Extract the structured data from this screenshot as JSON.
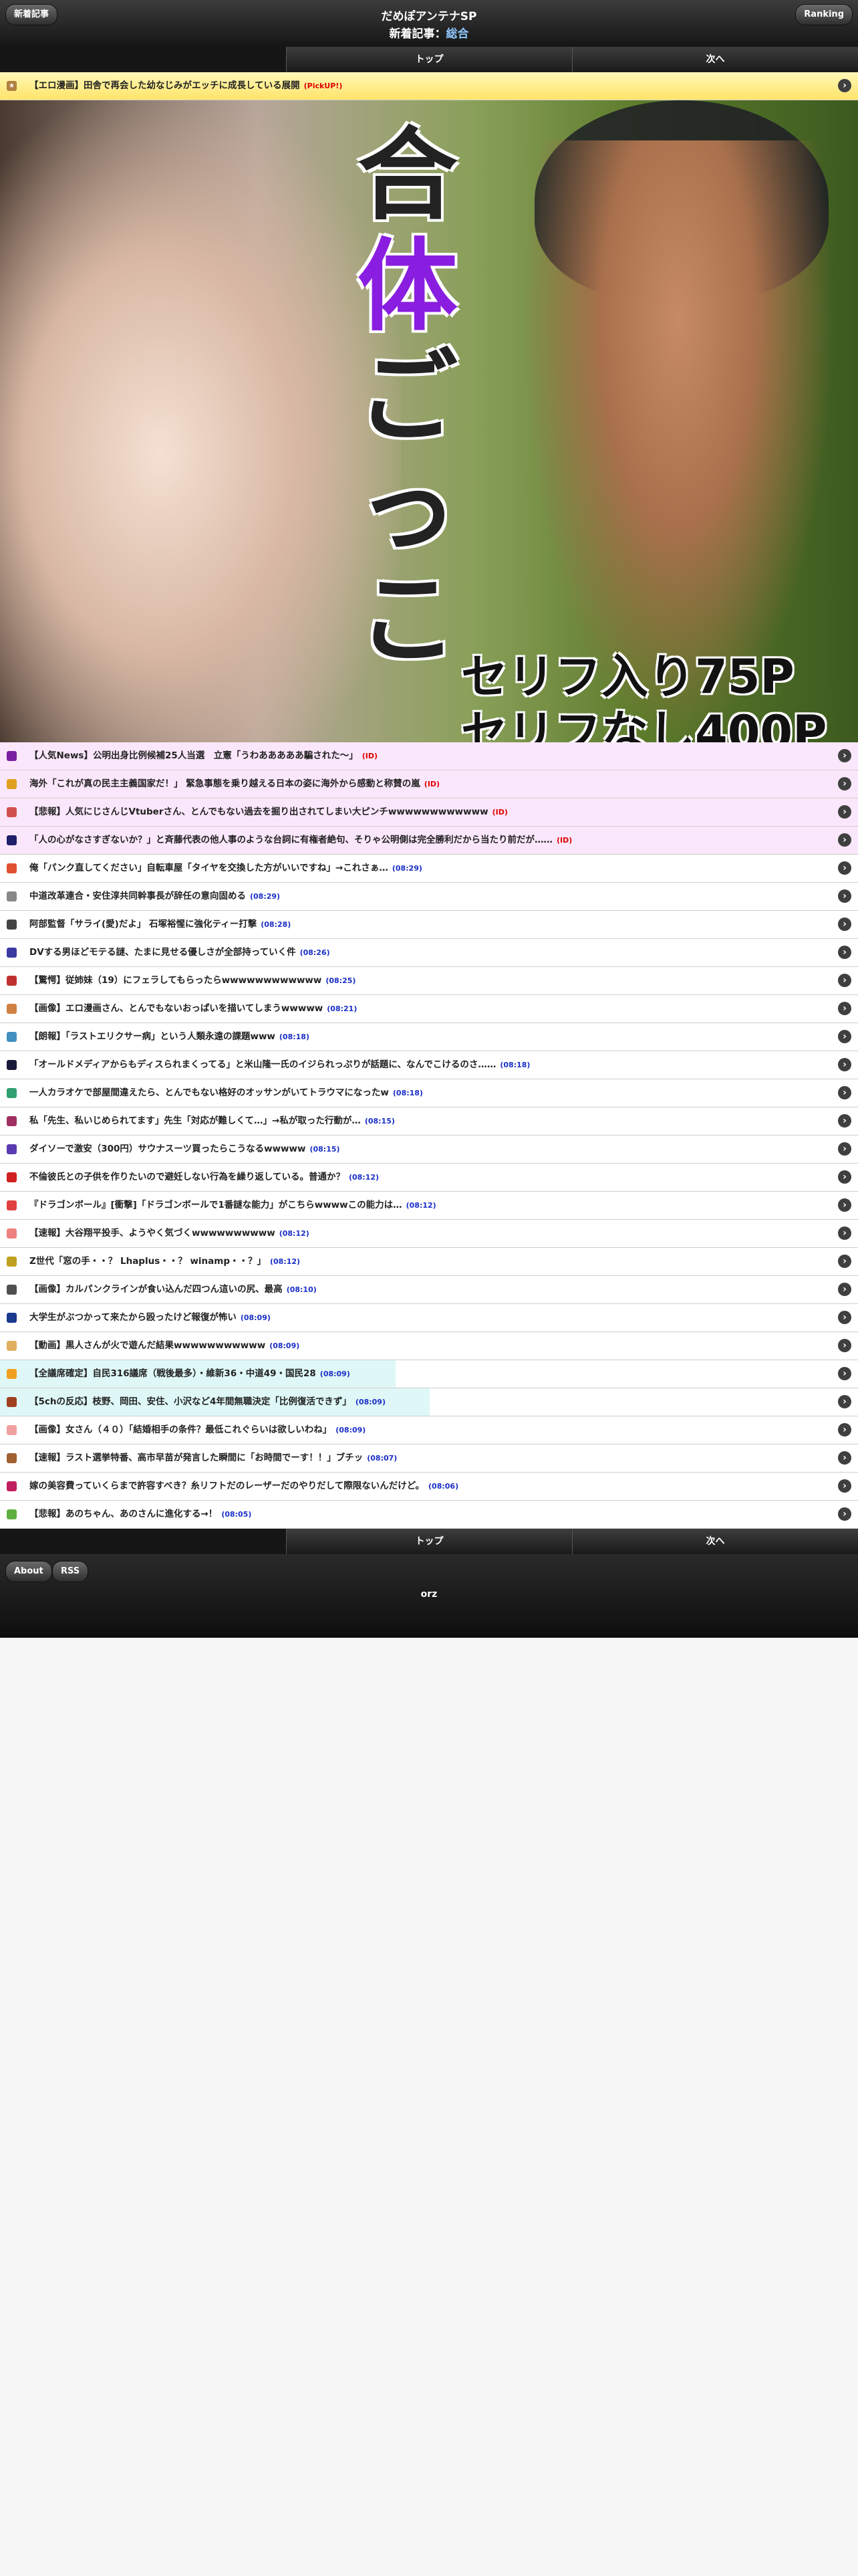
{
  "header": {
    "site": "だめぽアンテナSP",
    "sub_prefix": "新着記事：",
    "sub_category": "総合",
    "left_button": "新着記事",
    "right_button": "Ranking"
  },
  "nav": {
    "top": "トップ",
    "next": "次へ"
  },
  "pick": {
    "title": "【エロ漫画】田舎で再会した幼なじみがエッチに成長している展開",
    "mark": "(PickUP!)"
  },
  "hero": {
    "title_lines": [
      "合",
      "体",
      "ご",
      "っ",
      "こ"
    ],
    "caption_line1": "セリフ入り75P",
    "caption_line2": "セリフなし400P"
  },
  "articles": [
    {
      "title": "【人気News】公明出身比例候補25人当選　立憲「うわあああああ騙された〜」",
      "time": "(ID)",
      "style": "pink",
      "red": true,
      "icon_color": "#7a1fa0"
    },
    {
      "title": "海外「これが真の民主主義国家だ！」 緊急事態を乗り越える日本の姿に海外から感動と称賛の嵐",
      "time": "(ID)",
      "style": "pink",
      "red": true,
      "icon_color": "#e0a020"
    },
    {
      "title": "【悲報】人気にじさんじVtuberさん、とんでもない過去を掘り出されてしまい大ピンチwwwwwwwwwwww",
      "time": "(ID)",
      "style": "pink",
      "red": true,
      "icon_color": "#d05050"
    },
    {
      "title": "「人の心がなさすぎないか？」と斉藤代表の他人事のような台詞に有権者絶句、そりゃ公明側は完全勝利だから当たり前だが……",
      "time": "(ID)",
      "style": "pink",
      "red": true,
      "icon_color": "#1f1f6a"
    },
    {
      "title": "俺「パンク直してください」自転車屋「タイヤを交換した方がいいですね」→これさぁ…",
      "time": "(08:29)",
      "style": "",
      "icon_color": "#e05030"
    },
    {
      "title": "中道改革連合・安住淳共同幹事長が辞任の意向固める",
      "time": "(08:29)",
      "style": "",
      "icon_color": "#888888"
    },
    {
      "title": "阿部監督「サライ(愛)だよ」 石塚裕惺に強化ティー打撃",
      "time": "(08:28)",
      "style": "",
      "icon_color": "#444444"
    },
    {
      "title": "DVする男ほどモテる謎、たまに見せる優しさが全部持っていく件",
      "time": "(08:26)",
      "style": "",
      "icon_color": "#3a3aa0"
    },
    {
      "title": "【驚愕】従姉妹（19）にフェラしてもらったらwwwwwwwwwwww",
      "time": "(08:25)",
      "style": "",
      "icon_color": "#c03030"
    },
    {
      "title": "【画像】エロ漫画さん、とんでもないおっぱいを描いてしまうwwwww",
      "time": "(08:21)",
      "style": "",
      "icon_color": "#d08040"
    },
    {
      "title": "【朗報】「ラストエリクサー病」という人類永遠の課題www",
      "time": "(08:18)",
      "style": "",
      "icon_color": "#4090c0"
    },
    {
      "title": "「オールドメディアからもディスられまくってる」と米山隆一氏のイジられっぷりが話題に、なんでこけるのさ……",
      "time": "(08:18)",
      "style": "",
      "icon_color": "#1a1a3a"
    },
    {
      "title": "一人カラオケで部屋間違えたら、とんでもない格好のオッサンがいてトラウマになったw",
      "time": "(08:18)",
      "style": "",
      "icon_color": "#30a070"
    },
    {
      "title": "私「先生、私いじめられてます」先生「対応が難しくて…」→私が取った行動が…",
      "time": "(08:15)",
      "style": "",
      "icon_color": "#a03060"
    },
    {
      "title": "ダイソーで激安（300円）サウナスーツ買ったらこうなるwwwww",
      "time": "(08:15)",
      "style": "",
      "icon_color": "#5a3ab0"
    },
    {
      "title": "不倫彼氏との子供を作りたいので避妊しない行為を繰り返している。普通か？",
      "time": "(08:12)",
      "style": "",
      "icon_color": "#d02020"
    },
    {
      "title": "『ドラゴンボール』[衝撃]「ドラゴンボールで1番謎な能力」がこちらwwwwこの能力は…",
      "time": "(08:12)",
      "style": "",
      "icon_color": "#e04040"
    },
    {
      "title": "【速報】大谷翔平投手、ようやく気づくwwwwwwwwww",
      "time": "(08:12)",
      "style": "",
      "icon_color": "#f08080"
    },
    {
      "title": "Z世代「窓の手・・？ Lhaplus・・？ winamp・・？」",
      "time": "(08:12)",
      "style": "",
      "icon_color": "#c0a020"
    },
    {
      "title": "【画像】カルパンクラインが食い込んだ四つん這いの尻、最高",
      "time": "(08:10)",
      "style": "",
      "icon_color": "#505050"
    },
    {
      "title": "大学生がぶつかって来たから殴ったけど報復が怖い",
      "time": "(08:09)",
      "style": "",
      "icon_color": "#1a3a90"
    },
    {
      "title": "【動画】黒人さんが火で遊んだ結果wwwwwwwwwww",
      "time": "(08:09)",
      "style": "",
      "icon_color": "#e0b060"
    },
    {
      "title": "【全議席確定】自民316議席（戦後最多）・維新36・中道49・国民28",
      "time": "(08:09)",
      "style": "bar",
      "bar": 592,
      "icon_color": "#f0a020"
    },
    {
      "title": "【5chの反応】枝野、岡田、安住、小沢など4年間無職決定「比例復活できず」",
      "time": "(08:09)",
      "style": "bar",
      "bar": 643,
      "icon_color": "#a04020"
    },
    {
      "title": "【画像】女さん（４０）「結婚相手の条件？最低これぐらいは欲しいわね」",
      "time": "(08:09)",
      "style": "",
      "icon_color": "#f0a0a0"
    },
    {
      "title": "【速報】ラスト選挙特番、高市早苗が発言した瞬間に「お時間でーす！！」ブチッ",
      "time": "(08:07)",
      "style": "",
      "icon_color": "#a06030"
    },
    {
      "title": "嫁の美容費っていくらまで許容すべき？糸リフトだのレーザーだのやりだして際限ないんだけど。",
      "time": "(08:06)",
      "style": "",
      "icon_color": "#c02060"
    },
    {
      "title": "【悲報】あのちゃん、あのさんに進化する→！",
      "time": "(08:05)",
      "style": "",
      "icon_color": "#60b040"
    }
  ],
  "footer": {
    "about": "About",
    "rss": "RSS",
    "orz": "orz"
  }
}
